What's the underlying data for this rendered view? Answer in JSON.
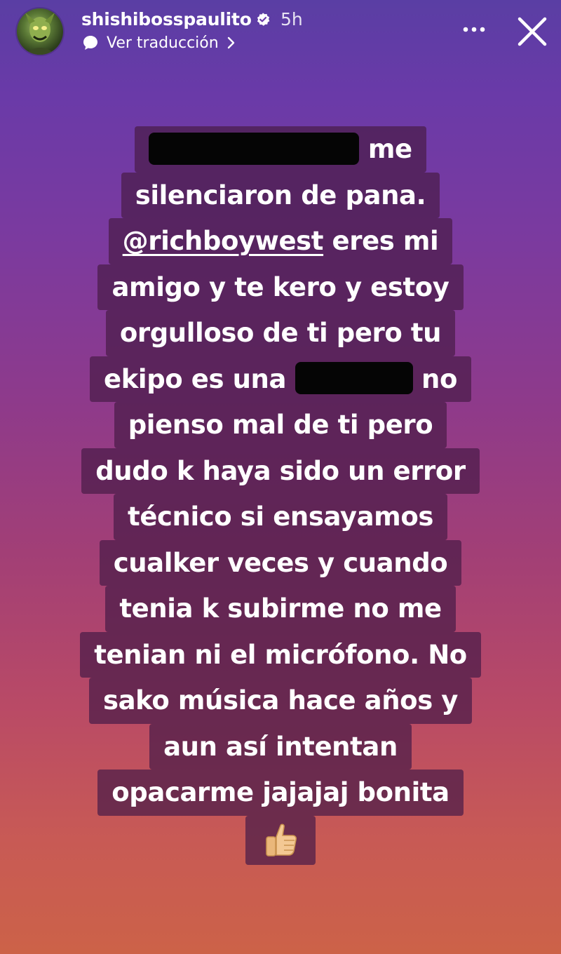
{
  "header": {
    "username": "shishibosspaulito",
    "time": "5h",
    "translate_label": "Ver traducción"
  },
  "story": {
    "line1_after": "me",
    "line2": "silenciaron de pana.",
    "mention": "@richboywest",
    "line3_after": " eres mi",
    "line4": "amigo y te kero y estoy",
    "line5": "orgulloso de ti pero tu",
    "line6_before": "ekipo es una ",
    "line6_after": " no",
    "line7": "pienso mal de ti pero",
    "line8": "dudo k haya sido un error",
    "line9": "técnico si ensayamos",
    "line10": "cualker veces y cuando",
    "line11": "tenia k subirme no me",
    "line12": "tenian ni el micrófono. No",
    "line13": "sako música hace años y",
    "line14": "aun así intentan",
    "line15": "opacarme jajajaj bonita",
    "emoji": "thumbs-up"
  },
  "colors": {
    "bg_top": "#5a3ea4",
    "bg_bottom": "#cc6248",
    "text_highlight": "#4a1c48",
    "verified_badge": "#ffffff",
    "thumb_skin": "#f3c893"
  }
}
